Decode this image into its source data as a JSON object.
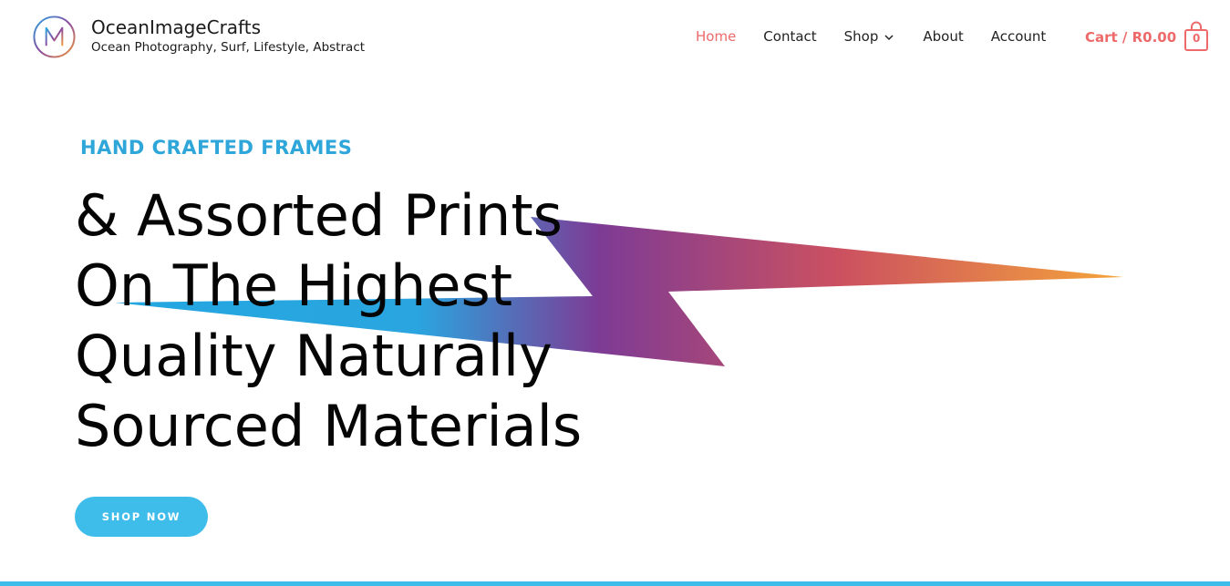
{
  "brand": {
    "title": "OceanImageCrafts",
    "tagline": "Ocean Photography, Surf, Lifestyle, Abstract",
    "logo_icon": "m-monogram-gradient-circle"
  },
  "nav": {
    "items": [
      {
        "label": "Home",
        "active": true
      },
      {
        "label": "Contact"
      },
      {
        "label": "Shop",
        "has_dropdown": true
      },
      {
        "label": "About"
      },
      {
        "label": "Account"
      }
    ]
  },
  "cart": {
    "label": "Cart / R0.00",
    "count": "0",
    "icon": "shopping-bag-icon"
  },
  "hero": {
    "eyebrow": "HAND CRAFTED FRAMES",
    "headline_lines": [
      "& Assorted Prints",
      "On The Highest",
      "Quality Naturally",
      "Sourced Materials"
    ],
    "cta": "SHOP NOW",
    "decoration": "lightning-bolt-gradient"
  },
  "colors": {
    "accent": "#ee6a6a",
    "eyebrow": "#2ea6d9",
    "button": "#3fbdea",
    "bolt_gradient": [
      "#2aa8e0",
      "#7b3a96",
      "#c9515f",
      "#f29a3a"
    ]
  }
}
